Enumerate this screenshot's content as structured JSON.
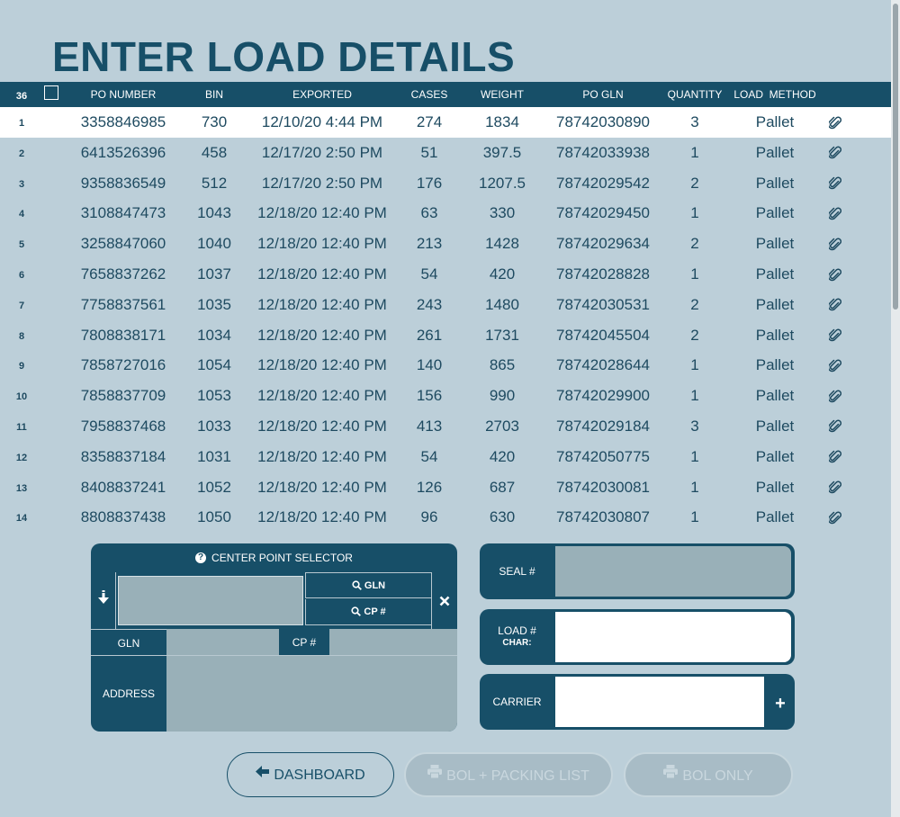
{
  "page": {
    "title": "ENTER LOAD DETAILS"
  },
  "table": {
    "count": "36",
    "headers": {
      "po_number": "PO NUMBER",
      "bin": "BIN",
      "exported": "EXPORTED",
      "cases": "CASES",
      "weight": "WEIGHT",
      "po_gln": "PO GLN",
      "quantity": "QUANTITY",
      "load_method": "LOAD  METHOD"
    },
    "rows": [
      {
        "n": "1",
        "po": "3358846985",
        "bin": "730",
        "exported": "12/10/20 4:44 PM",
        "cases": "274",
        "weight": "1834",
        "gln": "78742030890",
        "qty": "3",
        "method": "Pallet"
      },
      {
        "n": "2",
        "po": "6413526396",
        "bin": "458",
        "exported": "12/17/20 2:50 PM",
        "cases": "51",
        "weight": "397.5",
        "gln": "78742033938",
        "qty": "1",
        "method": "Pallet"
      },
      {
        "n": "3",
        "po": "9358836549",
        "bin": "512",
        "exported": "12/17/20 2:50 PM",
        "cases": "176",
        "weight": "1207.5",
        "gln": "78742029542",
        "qty": "2",
        "method": "Pallet"
      },
      {
        "n": "4",
        "po": "3108847473",
        "bin": "1043",
        "exported": "12/18/20 12:40 PM",
        "cases": "63",
        "weight": "330",
        "gln": "78742029450",
        "qty": "1",
        "method": "Pallet"
      },
      {
        "n": "5",
        "po": "3258847060",
        "bin": "1040",
        "exported": "12/18/20 12:40 PM",
        "cases": "213",
        "weight": "1428",
        "gln": "78742029634",
        "qty": "2",
        "method": "Pallet"
      },
      {
        "n": "6",
        "po": "7658837262",
        "bin": "1037",
        "exported": "12/18/20 12:40 PM",
        "cases": "54",
        "weight": "420",
        "gln": "78742028828",
        "qty": "1",
        "method": "Pallet"
      },
      {
        "n": "7",
        "po": "7758837561",
        "bin": "1035",
        "exported": "12/18/20 12:40 PM",
        "cases": "243",
        "weight": "1480",
        "gln": "78742030531",
        "qty": "2",
        "method": "Pallet"
      },
      {
        "n": "8",
        "po": "7808838171",
        "bin": "1034",
        "exported": "12/18/20 12:40 PM",
        "cases": "261",
        "weight": "1731",
        "gln": "78742045504",
        "qty": "2",
        "method": "Pallet"
      },
      {
        "n": "9",
        "po": "7858727016",
        "bin": "1054",
        "exported": "12/18/20 12:40 PM",
        "cases": "140",
        "weight": "865",
        "gln": "78742028644",
        "qty": "1",
        "method": "Pallet"
      },
      {
        "n": "10",
        "po": "7858837709",
        "bin": "1053",
        "exported": "12/18/20 12:40 PM",
        "cases": "156",
        "weight": "990",
        "gln": "78742029900",
        "qty": "1",
        "method": "Pallet"
      },
      {
        "n": "11",
        "po": "7958837468",
        "bin": "1033",
        "exported": "12/18/20 12:40 PM",
        "cases": "413",
        "weight": "2703",
        "gln": "78742029184",
        "qty": "3",
        "method": "Pallet"
      },
      {
        "n": "12",
        "po": "8358837184",
        "bin": "1031",
        "exported": "12/18/20 12:40 PM",
        "cases": "54",
        "weight": "420",
        "gln": "78742050775",
        "qty": "1",
        "method": "Pallet"
      },
      {
        "n": "13",
        "po": "8408837241",
        "bin": "1052",
        "exported": "12/18/20 12:40 PM",
        "cases": "126",
        "weight": "687",
        "gln": "78742030081",
        "qty": "1",
        "method": "Pallet"
      },
      {
        "n": "14",
        "po": "8808837438",
        "bin": "1050",
        "exported": "12/18/20 12:40 PM",
        "cases": "96",
        "weight": "630",
        "gln": "78742030807",
        "qty": "1",
        "method": "Pallet"
      }
    ],
    "row_icon": "paperclip-icon"
  },
  "center_point_selector": {
    "title": "CENTER POINT SELECTOR",
    "gln_button": "GLN",
    "cp_button": "CP #",
    "gln_label": "GLN",
    "cp_label": "CP #",
    "address_label": "ADDRESS"
  },
  "fields": {
    "seal_label": "SEAL #",
    "load_label": "LOAD #",
    "load_sub": "CHAR:",
    "carrier_label": "CARRIER"
  },
  "buttons": {
    "dashboard": "DASHBOARD",
    "bol_packing": "BOL + PACKING LIST",
    "bol_only": "BOL ONLY"
  },
  "colors": {
    "background": "#bccfd9",
    "header": "#174f68",
    "field_fill": "#99b0b8",
    "disabled": "#a8bcc6"
  }
}
